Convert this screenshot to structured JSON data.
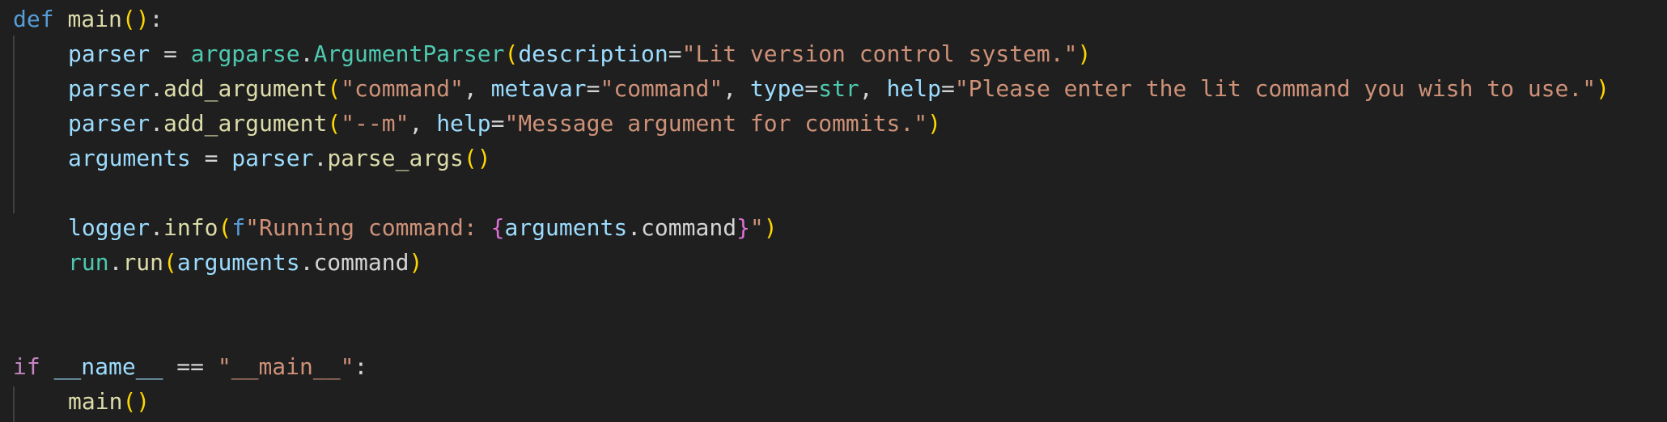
{
  "editor": {
    "theme": "dark",
    "background": "#1f1f1f",
    "colors": {
      "keyword": "#569cd6",
      "control": "#c586c0",
      "function": "#dcdcaa",
      "variable": "#9cdcfe",
      "class": "#4ec9b0",
      "string": "#ce9178",
      "bracket_level1": "#ffd700",
      "bracket_level2": "#da70d6",
      "bracket_level3": "#179fff"
    },
    "lines": [
      {
        "tokens": [
          {
            "t": "def",
            "c": "kw"
          },
          {
            "t": " ",
            "c": "op"
          },
          {
            "t": "main",
            "c": "fn"
          },
          {
            "t": "()",
            "c": "br1"
          },
          {
            "t": ":",
            "c": "op"
          }
        ]
      },
      {
        "tokens": [
          {
            "t": "parser",
            "c": "var"
          },
          {
            "t": " = ",
            "c": "op"
          },
          {
            "t": "argparse",
            "c": "cls"
          },
          {
            "t": ".",
            "c": "op"
          },
          {
            "t": "ArgumentParser",
            "c": "cls"
          },
          {
            "t": "(",
            "c": "br1"
          },
          {
            "t": "description",
            "c": "prm"
          },
          {
            "t": "=",
            "c": "op"
          },
          {
            "t": "\"Lit version control system.\"",
            "c": "str"
          },
          {
            "t": ")",
            "c": "br1"
          }
        ]
      },
      {
        "tokens": [
          {
            "t": "parser",
            "c": "var"
          },
          {
            "t": ".",
            "c": "op"
          },
          {
            "t": "add_argument",
            "c": "fn"
          },
          {
            "t": "(",
            "c": "br1"
          },
          {
            "t": "\"command\"",
            "c": "str"
          },
          {
            "t": ", ",
            "c": "op"
          },
          {
            "t": "metavar",
            "c": "prm"
          },
          {
            "t": "=",
            "c": "op"
          },
          {
            "t": "\"command\"",
            "c": "str"
          },
          {
            "t": ", ",
            "c": "op"
          },
          {
            "t": "type",
            "c": "prm"
          },
          {
            "t": "=",
            "c": "op"
          },
          {
            "t": "str",
            "c": "cls"
          },
          {
            "t": ", ",
            "c": "op"
          },
          {
            "t": "help",
            "c": "prm"
          },
          {
            "t": "=",
            "c": "op"
          },
          {
            "t": "\"Please enter the lit command you wish to use.\"",
            "c": "str"
          },
          {
            "t": ")",
            "c": "br1"
          }
        ]
      },
      {
        "tokens": [
          {
            "t": "parser",
            "c": "var"
          },
          {
            "t": ".",
            "c": "op"
          },
          {
            "t": "add_argument",
            "c": "fn"
          },
          {
            "t": "(",
            "c": "br1"
          },
          {
            "t": "\"--m\"",
            "c": "str"
          },
          {
            "t": ", ",
            "c": "op"
          },
          {
            "t": "help",
            "c": "prm"
          },
          {
            "t": "=",
            "c": "op"
          },
          {
            "t": "\"Message argument for commits.\"",
            "c": "str"
          },
          {
            "t": ")",
            "c": "br1"
          }
        ]
      },
      {
        "tokens": [
          {
            "t": "arguments",
            "c": "var"
          },
          {
            "t": " = ",
            "c": "op"
          },
          {
            "t": "parser",
            "c": "var"
          },
          {
            "t": ".",
            "c": "op"
          },
          {
            "t": "parse_args",
            "c": "fn"
          },
          {
            "t": "()",
            "c": "br1"
          }
        ]
      },
      {
        "tokens": []
      },
      {
        "tokens": [
          {
            "t": "logger",
            "c": "var"
          },
          {
            "t": ".",
            "c": "op"
          },
          {
            "t": "info",
            "c": "fn"
          },
          {
            "t": "(",
            "c": "br1"
          },
          {
            "t": "f",
            "c": "kw"
          },
          {
            "t": "\"Running command: ",
            "c": "str"
          },
          {
            "t": "{",
            "c": "br2"
          },
          {
            "t": "arguments",
            "c": "var"
          },
          {
            "t": ".",
            "c": "op"
          },
          {
            "t": "command",
            "c": "op"
          },
          {
            "t": "}",
            "c": "br2"
          },
          {
            "t": "\"",
            "c": "str"
          },
          {
            "t": ")",
            "c": "br1"
          }
        ]
      },
      {
        "tokens": [
          {
            "t": "run",
            "c": "cls"
          },
          {
            "t": ".",
            "c": "op"
          },
          {
            "t": "run",
            "c": "fn"
          },
          {
            "t": "(",
            "c": "br1"
          },
          {
            "t": "arguments",
            "c": "var"
          },
          {
            "t": ".",
            "c": "op"
          },
          {
            "t": "command",
            "c": "op"
          },
          {
            "t": ")",
            "c": "br1"
          }
        ]
      },
      {
        "tokens": []
      },
      {
        "tokens": []
      },
      {
        "tokens": [
          {
            "t": "if",
            "c": "kw2"
          },
          {
            "t": " ",
            "c": "op"
          },
          {
            "t": "__name__",
            "c": "var"
          },
          {
            "t": " == ",
            "c": "op"
          },
          {
            "t": "\"__main__\"",
            "c": "str"
          },
          {
            "t": ":",
            "c": "op"
          }
        ]
      },
      {
        "tokens": [
          {
            "t": "main",
            "c": "fn"
          },
          {
            "t": "()",
            "c": "br1"
          }
        ]
      }
    ]
  }
}
